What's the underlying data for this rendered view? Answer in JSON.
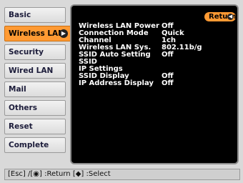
{
  "sidebar": {
    "items": [
      {
        "label": "Basic"
      },
      {
        "label": "Wireless LAN"
      },
      {
        "label": "Security"
      },
      {
        "label": "Wired LAN"
      },
      {
        "label": "Mail"
      },
      {
        "label": "Others"
      },
      {
        "label": "Reset"
      },
      {
        "label": "Complete"
      }
    ],
    "active_index": 1
  },
  "panel": {
    "return_label": "Return",
    "rows": [
      {
        "label": "Wireless LAN Power",
        "value": "Off"
      },
      {
        "label": "Connection Mode",
        "value": "Quick"
      },
      {
        "label": "Channel",
        "value": "1ch"
      },
      {
        "label": "Wireless LAN Sys.",
        "value": "802.11b/g"
      },
      {
        "label": "SSID Auto Setting",
        "value": "Off"
      },
      {
        "label": "SSID",
        "value": ""
      },
      {
        "label": "IP Settings",
        "value": ""
      },
      {
        "label": "SSID Display",
        "value": "Off"
      },
      {
        "label": "IP Address Display",
        "value": "Off"
      }
    ]
  },
  "footer": {
    "text": "[Esc] /[◉] :Return  [◆] :Select"
  },
  "colors": {
    "accent": "#ff9a33",
    "panel_bg": "#000000"
  }
}
